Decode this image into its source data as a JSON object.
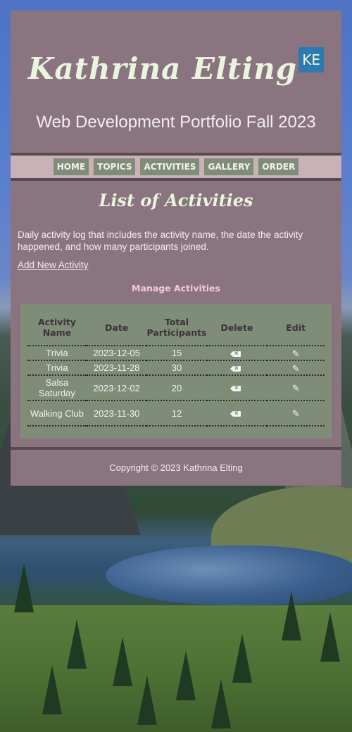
{
  "header": {
    "site_title": "Kathrina Elting",
    "logo_text": "KE",
    "subtitle": "Web Development Portfolio Fall 2023"
  },
  "nav": {
    "items": [
      {
        "label": "HOME"
      },
      {
        "label": "TOPICS"
      },
      {
        "label": "ACTIVITIES"
      },
      {
        "label": "GALLERY"
      },
      {
        "label": "ORDER"
      }
    ]
  },
  "main": {
    "page_title": "List of Activities",
    "intro": "Daily activity log that includes the activity name, the date the activity happened, and how many participants joined.",
    "add_link": "Add New Activity",
    "manage_title": "Manage Activities"
  },
  "table": {
    "columns": [
      "Activity Name",
      "Date",
      "Total Participants",
      "Delete",
      "Edit"
    ],
    "rows": [
      {
        "name": "Trivia",
        "date": "2023-12-05",
        "participants": "15"
      },
      {
        "name": "Trivia",
        "date": "2023-11-28",
        "participants": "30"
      },
      {
        "name": "Salsa Saturday",
        "date": "2023-12-02",
        "participants": "20"
      },
      {
        "name": "Walking Club",
        "date": "2023-11-30",
        "participants": "12"
      }
    ],
    "delete_icon": "backspace-x-icon",
    "edit_icon": "pencil-icon"
  },
  "footer": {
    "copyright": "Copyright © 2023 Kathrina Elting"
  },
  "colors": {
    "card_bg": "#8a747f",
    "nav_bg": "#c9b1b8",
    "button_bg": "#7f8c78",
    "title_text": "#e9f5dd",
    "accent_pink": "#f6c9d6",
    "logo_bg": "#2f79b3"
  }
}
